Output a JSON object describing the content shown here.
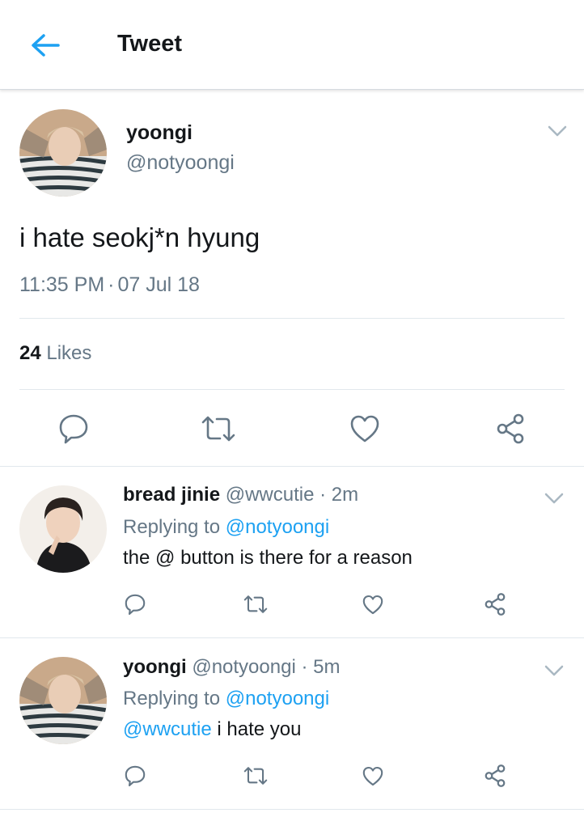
{
  "header": {
    "title": "Tweet"
  },
  "tweet": {
    "author_name": "yoongi",
    "author_handle": "@notyoongi",
    "text": "i hate seokj*n hyung",
    "time": "11:35 PM",
    "separator": "·",
    "date": "07 Jul 18",
    "likes_count": "24",
    "likes_label": "Likes"
  },
  "replies": [
    {
      "name": "bread jinie",
      "handle": "@wwcutie",
      "separator": "·",
      "age": "2m",
      "replying_label": "Replying to",
      "replying_to": "@notyoongi",
      "mention": "",
      "text": "the @ button is there for a reason"
    },
    {
      "name": "yoongi",
      "handle": "@notyoongi",
      "separator": "·",
      "age": "5m",
      "replying_label": "Replying to",
      "replying_to": "@notyoongi",
      "mention": "@wwcutie",
      "text": "i hate you"
    }
  ],
  "icons": [
    "back-arrow-icon",
    "chevron-down-icon",
    "reply-icon",
    "retweet-icon",
    "like-icon",
    "share-icon"
  ],
  "colors": {
    "accent": "#1da1f2",
    "text": "#14171a",
    "secondary_text": "#657786",
    "icon": "#657786",
    "divider": "#e1e8ed"
  }
}
